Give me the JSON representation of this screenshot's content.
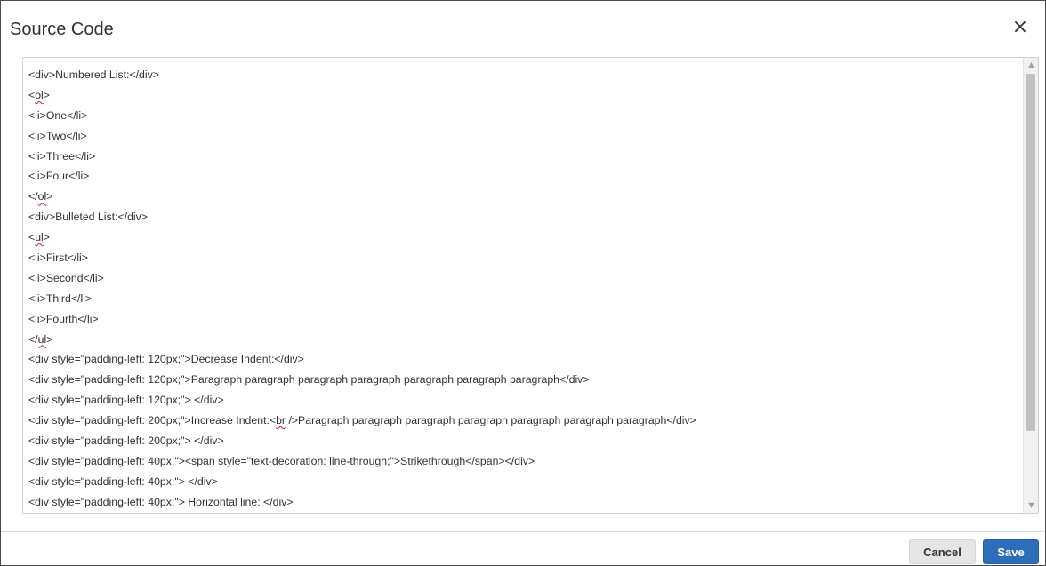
{
  "dialog": {
    "title": "Source Code",
    "close_label": "×"
  },
  "editor": {
    "lines": [
      [
        {
          "t": "<div>Numbered List:</div>"
        }
      ],
      [
        {
          "t": "<"
        },
        {
          "t": "ol",
          "s": true
        },
        {
          "t": ">"
        }
      ],
      [
        {
          "t": "<li>One</li>"
        }
      ],
      [
        {
          "t": "<li>Two</li>"
        }
      ],
      [
        {
          "t": "<li>Three</li>"
        }
      ],
      [
        {
          "t": "<li>Four</li>"
        }
      ],
      [
        {
          "t": "</"
        },
        {
          "t": "ol",
          "s": true
        },
        {
          "t": ">"
        }
      ],
      [
        {
          "t": "<div>Bulleted List:</div>"
        }
      ],
      [
        {
          "t": "<"
        },
        {
          "t": "ul",
          "s": true
        },
        {
          "t": ">"
        }
      ],
      [
        {
          "t": "<li>First</li>"
        }
      ],
      [
        {
          "t": "<li>Second</li>"
        }
      ],
      [
        {
          "t": "<li>Third</li>"
        }
      ],
      [
        {
          "t": "<li>Fourth</li>"
        }
      ],
      [
        {
          "t": "</"
        },
        {
          "t": "ul",
          "s": true
        },
        {
          "t": ">"
        }
      ],
      [
        {
          "t": "<div style=\"padding-left: 120px;\">Decrease Indent:</div>"
        }
      ],
      [
        {
          "t": "<div style=\"padding-left: 120px;\">Paragraph paragraph paragraph paragraph paragraph paragraph paragraph</div>"
        }
      ],
      [
        {
          "t": "<div style=\"padding-left: 120px;\"> </div>"
        }
      ],
      [
        {
          "t": "<div style=\"padding-left: 200px;\">Increase Indent:<"
        },
        {
          "t": "br",
          "s": true
        },
        {
          "t": " />Paragraph paragraph paragraph paragraph paragraph paragraph paragraph</div>"
        }
      ],
      [
        {
          "t": "<div style=\"padding-left: 200px;\"> </div>"
        }
      ],
      [
        {
          "t": "<div style=\"padding-left: 40px;\"><span style=\"text-decoration: line-through;\">Strikethrough</span></div>"
        }
      ],
      [
        {
          "t": "<div style=\"padding-left: 40px;\"> </div>"
        }
      ],
      [
        {
          "t": "<div style=\"padding-left: 40px;\"> Horizontal line: </div>"
        }
      ]
    ]
  },
  "footer": {
    "cancel_label": "Cancel",
    "save_label": "Save"
  },
  "scrollbar": {
    "up_arrow": "▲",
    "down_arrow": "▼"
  }
}
